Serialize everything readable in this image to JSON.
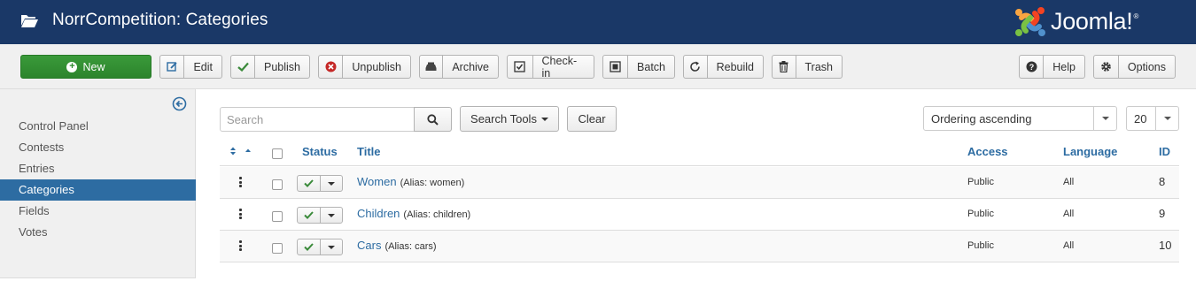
{
  "header": {
    "title": "NorrCompetition: Categories",
    "logo_text": "Joomla!",
    "logo_reg": "®",
    "bg_color": "#1a3867"
  },
  "toolbar": {
    "new_label": "New",
    "edit_label": "Edit",
    "publish_label": "Publish",
    "unpublish_label": "Unpublish",
    "archive_label": "Archive",
    "checkin_label": "Check-in",
    "batch_label": "Batch",
    "rebuild_label": "Rebuild",
    "trash_label": "Trash",
    "help_label": "Help",
    "options_label": "Options"
  },
  "sidebar": {
    "items": [
      {
        "label": "Control Panel",
        "active": false
      },
      {
        "label": "Contests",
        "active": false
      },
      {
        "label": "Entries",
        "active": false
      },
      {
        "label": "Categories",
        "active": true
      },
      {
        "label": "Fields",
        "active": false
      },
      {
        "label": "Votes",
        "active": false
      }
    ]
  },
  "filters": {
    "search_placeholder": "Search",
    "search_tools_label": "Search Tools",
    "clear_label": "Clear",
    "ordering_value": "Ordering ascending",
    "limit_value": "20"
  },
  "table": {
    "headers": {
      "status": "Status",
      "title": "Title",
      "access": "Access",
      "language": "Language",
      "id": "ID"
    },
    "rows": [
      {
        "title": "Women",
        "alias": "(Alias: women)",
        "access": "Public",
        "language": "All",
        "id": "8"
      },
      {
        "title": "Children",
        "alias": "(Alias: children)",
        "access": "Public",
        "language": "All",
        "id": "9"
      },
      {
        "title": "Cars",
        "alias": "(Alias: cars)",
        "access": "Public",
        "language": "All",
        "id": "10"
      }
    ]
  },
  "colors": {
    "accent": "#2d6ca2",
    "new_button": "#2f8b2f",
    "published_check": "#3a8a3a",
    "unpublish_icon": "#c52827"
  }
}
